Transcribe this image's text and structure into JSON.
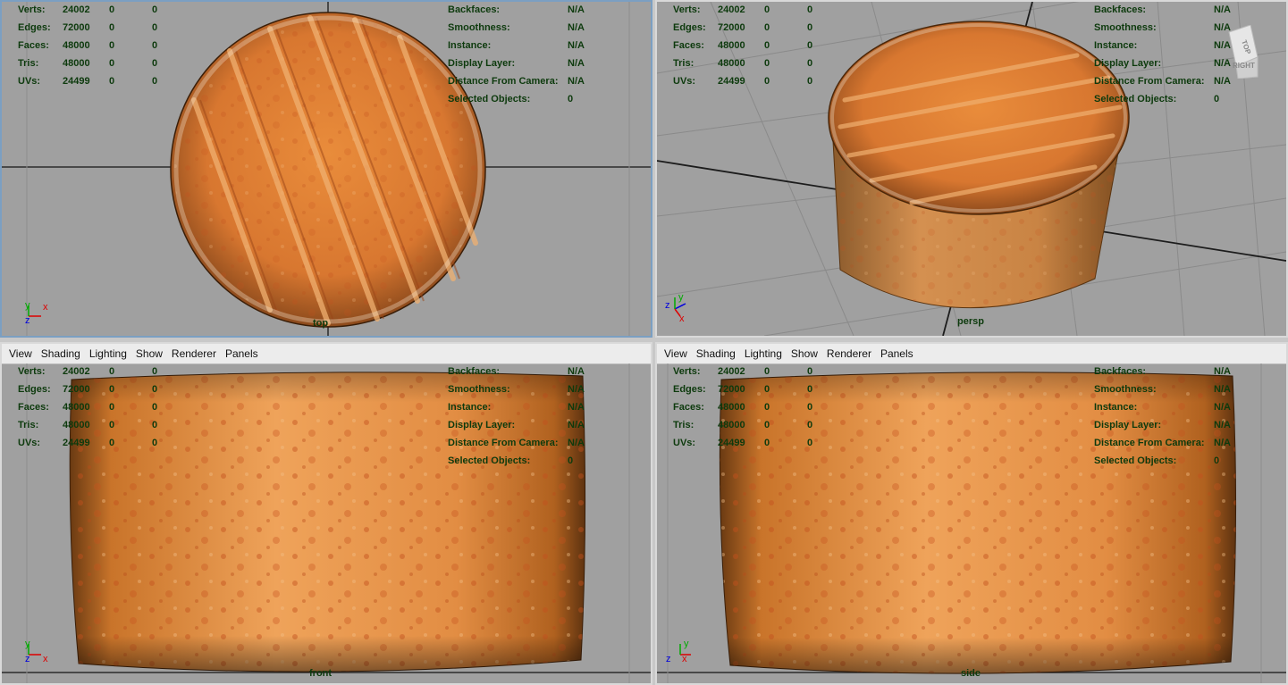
{
  "menus": [
    "View",
    "Shading",
    "Lighting",
    "Show",
    "Renderer",
    "Panels"
  ],
  "hud_left": [
    {
      "label": "Verts:",
      "v1": "24002",
      "v2": "0",
      "v3": "0"
    },
    {
      "label": "Edges:",
      "v1": "72000",
      "v2": "0",
      "v3": "0"
    },
    {
      "label": "Faces:",
      "v1": "48000",
      "v2": "0",
      "v3": "0"
    },
    {
      "label": "Tris:",
      "v1": "48000",
      "v2": "0",
      "v3": "0"
    },
    {
      "label": "UVs:",
      "v1": "24499",
      "v2": "0",
      "v3": "0"
    }
  ],
  "hud_right": [
    {
      "label": "Backfaces:",
      "value": "N/A"
    },
    {
      "label": "Smoothness:",
      "value": "N/A"
    },
    {
      "label": "Instance:",
      "value": "N/A"
    },
    {
      "label": "Display Layer:",
      "value": "N/A"
    },
    {
      "label": "Distance From Camera:",
      "value": "N/A"
    },
    {
      "label": "Selected Objects:",
      "value": "0"
    }
  ],
  "viewports": {
    "top": {
      "camera": "top"
    },
    "persp": {
      "camera": "persp"
    },
    "front": {
      "camera": "front"
    },
    "side": {
      "camera": "side"
    }
  },
  "viewcube": {
    "top": "TOP",
    "right": "RIGHT"
  },
  "axis_labels": {
    "x": "x",
    "y": "y",
    "z": "z"
  },
  "colors": {
    "viewport_bg": "#a0a0a0",
    "hud_text": "#0d3a0d",
    "cheese_rind": "#d9782c",
    "active_border": "#7b9fc2"
  }
}
